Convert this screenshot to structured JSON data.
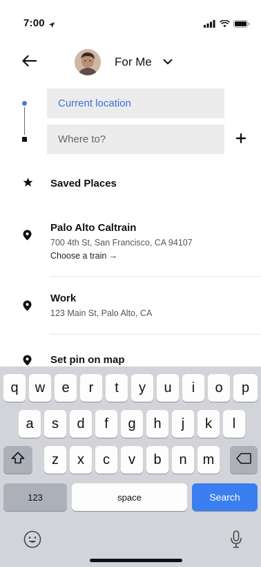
{
  "status_bar": {
    "time": "7:00",
    "location_icon": "location-arrow-icon",
    "signal_icon": "signal-bars-icon",
    "wifi_icon": "wifi-icon",
    "battery_icon": "battery-icon"
  },
  "header": {
    "back_icon": "arrow-left-icon",
    "rider_label": "For Me",
    "dropdown_icon": "chevron-down-icon"
  },
  "route": {
    "pickup_placeholder": "Current location",
    "destination_placeholder": "Where to?",
    "add_stop_icon": "plus-icon"
  },
  "list": {
    "saved_places": {
      "icon": "star-icon",
      "label": "Saved Places"
    },
    "items": [
      {
        "icon": "map-pin-icon",
        "title": "Palo Alto Caltrain",
        "address": "700 4th St, San Francisco, CA 94107",
        "action": "Choose a train →"
      },
      {
        "icon": "map-pin-icon",
        "title": "Work",
        "address": "123 Main St, Palo Alto, CA"
      }
    ],
    "set_pin": {
      "icon": "map-pin-icon",
      "label": "Set pin on map"
    }
  },
  "keyboard": {
    "row1": [
      "q",
      "w",
      "e",
      "r",
      "t",
      "y",
      "u",
      "i",
      "o",
      "p"
    ],
    "row2": [
      "a",
      "s",
      "d",
      "f",
      "g",
      "h",
      "j",
      "k",
      "l"
    ],
    "row3": [
      "z",
      "x",
      "c",
      "v",
      "b",
      "n",
      "m"
    ],
    "numbers_label": "123",
    "space_label": "space",
    "search_label": "Search",
    "shift_icon": "shift-icon",
    "delete_icon": "delete-icon",
    "emoji_icon": "emoji-icon",
    "mic_icon": "microphone-icon"
  },
  "colors": {
    "accent_blue": "#3b7ef0",
    "pickup_text": "#3d6fd3",
    "keyboard_bg": "#d2d4da"
  }
}
